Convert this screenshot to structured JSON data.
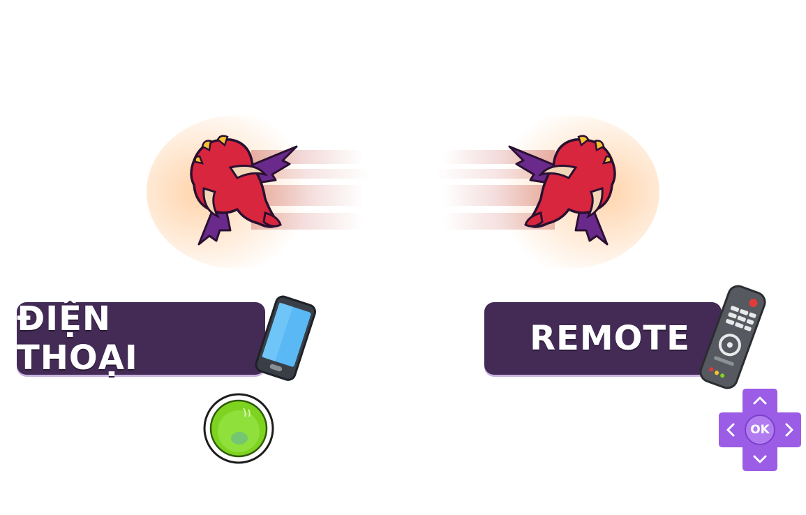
{
  "left_option": {
    "label": "ĐIỆN THOẠI",
    "icon": "smartphone-icon"
  },
  "right_option": {
    "label": "REMOTE",
    "icon": "tv-remote-icon"
  },
  "confirm_button": {
    "icon": "green-orb-button"
  },
  "dpad": {
    "center_label": "OK",
    "icon": "dpad-icon"
  },
  "colors": {
    "label_bg": "#432b56",
    "dragon_red": "#d8263e",
    "wing_purple": "#6a2a8c",
    "green": "#7ed321",
    "dpad_purple": "#9b5de5"
  }
}
